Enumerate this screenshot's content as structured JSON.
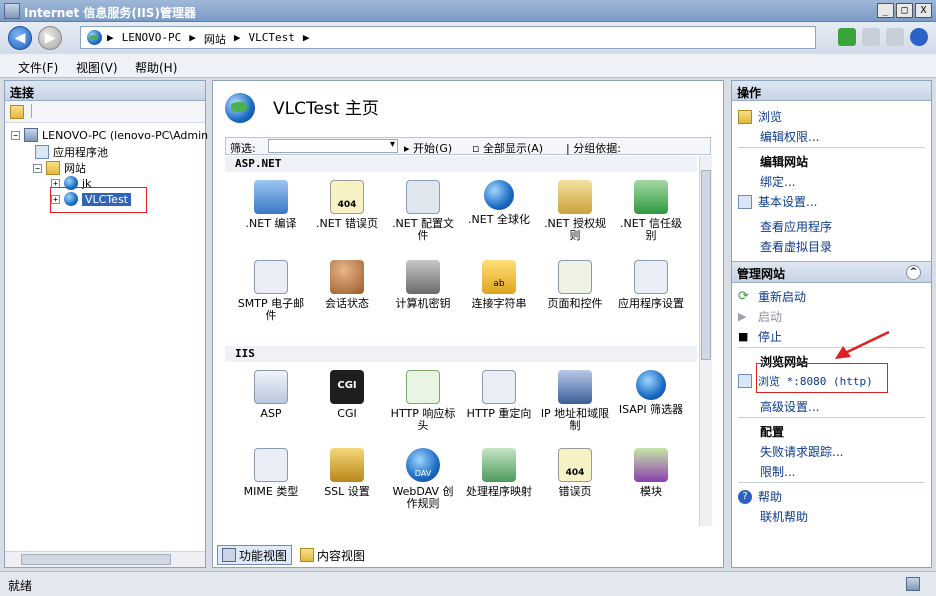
{
  "window": {
    "title": "Internet 信息服务(IIS)管理器",
    "buttons": [
      "_",
      "□",
      "X"
    ]
  },
  "address": {
    "crumbs": [
      "LENOVO-PC",
      "网站",
      "VLCTest"
    ],
    "separators": [
      "▶",
      "▶",
      "▶",
      "▶"
    ]
  },
  "menu": [
    "文件(F)",
    "视图(V)",
    "帮助(H)"
  ],
  "connections": {
    "title": "连接",
    "tree": {
      "server": "LENOVO-PC (lenovo-PC\\Admin",
      "app_pools": "应用程序池",
      "sites": "网站",
      "site1": "jk",
      "site2": "VLCTest"
    }
  },
  "center": {
    "title": "VLCTest 主页",
    "filter": {
      "label": "筛选:",
      "start": "开始(G)",
      "show_all": "全部显示(A)",
      "group_by": "分组依据:"
    },
    "groups": [
      {
        "name": "ASP.NET",
        "items": [
          ".NET 编译",
          ".NET 错误页",
          ".NET 配置文件",
          ".NET 全球化",
          ".NET 授权规则",
          ".NET 信任级别",
          "SMTP 电子邮件",
          "会话状态",
          "计算机密钥",
          "连接字符串",
          "页面和控件",
          "应用程序设置"
        ]
      },
      {
        "name": "IIS",
        "items": [
          "ASP",
          "CGI",
          "HTTP 响应标头",
          "HTTP 重定向",
          "IP 地址和域限制",
          "ISAPI 筛选器",
          "MIME 类型",
          "SSL 设置",
          "WebDAV 创作规则",
          "处理程序映射",
          "错误页",
          "模块"
        ]
      }
    ],
    "icon_texts": {
      "cgi": "CGI",
      "err404": "404",
      "dav": "DAV",
      "ab": "ab"
    },
    "view_tabs": [
      "功能视图",
      "内容视图"
    ]
  },
  "actions": {
    "title": "操作",
    "browse": "浏览",
    "edit_perms": "编辑权限...",
    "edit_site_head": "编辑网站",
    "bindings": "绑定...",
    "basic_settings": "基本设置...",
    "view_apps": "查看应用程序",
    "view_vdirs": "查看虚拟目录",
    "manage_site": "管理网站",
    "collapse": "^",
    "restart": "重新启动",
    "start": "启动",
    "stop": "停止",
    "browse_site_head": "浏览网站",
    "browse_8080": "浏览 *:8080 (http)",
    "advanced": "高级设置...",
    "config_head": "配置",
    "failed_trace": "失败请求跟踪...",
    "limits": "限制...",
    "help": "帮助",
    "online_help": "联机帮助"
  },
  "status": {
    "text": "就绪"
  },
  "colors": {
    "accent": "#3163b8",
    "highlight_box": "#e02020",
    "link": "#0b3a8c"
  }
}
